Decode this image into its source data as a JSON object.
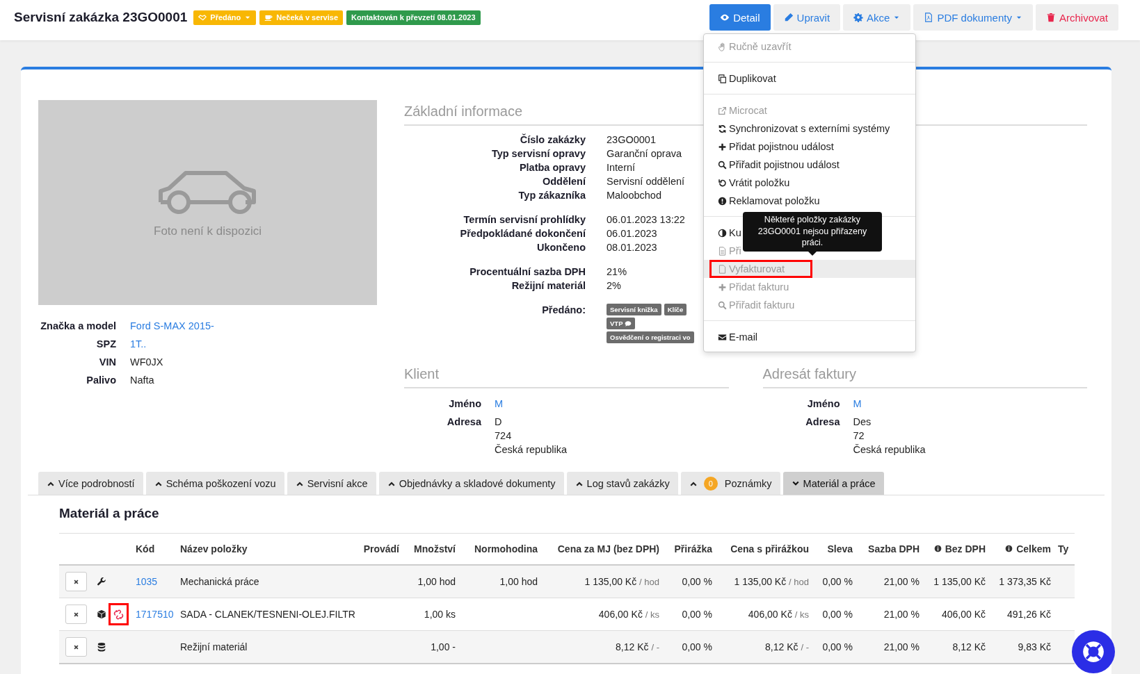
{
  "header": {
    "title": "Servisní zakázka 23GO0001",
    "badges": [
      {
        "label": "Předáno",
        "color": "#f8b704",
        "dropdown": true
      },
      {
        "label": "Nečeká v servise",
        "color": "#f8b704",
        "dropdown": false
      },
      {
        "label": "Kontaktován k převzetí 08.01.2023",
        "color": "#2f9a4c",
        "dropdown": false
      }
    ],
    "actions": [
      {
        "label": "Detail",
        "selected": true,
        "dropdown": false,
        "kind": "normal"
      },
      {
        "label": "Upravit",
        "selected": false,
        "dropdown": false,
        "kind": "normal"
      },
      {
        "label": "Akce",
        "selected": false,
        "dropdown": true,
        "kind": "normal"
      },
      {
        "label": "PDF dokumenty",
        "selected": false,
        "dropdown": true,
        "kind": "normal"
      },
      {
        "label": "Archivovat",
        "selected": false,
        "dropdown": false,
        "kind": "danger"
      }
    ]
  },
  "photo": {
    "caption": "Foto není k dispozici"
  },
  "vehicle": [
    {
      "label": "Značka a model",
      "value": "Ford S-MAX 2015-",
      "link": true
    },
    {
      "label": "SPZ",
      "value": "1T..",
      "link": true
    },
    {
      "label": "VIN",
      "value": "WF0JX",
      "link": false
    },
    {
      "label": "Palivo",
      "value": "Nafta",
      "link": false
    }
  ],
  "basic_info": {
    "title": "Základní informace",
    "groups": [
      [
        {
          "label": "Číslo zakázky",
          "value": "23GO0001"
        },
        {
          "label": "Typ servisní opravy",
          "value": "Garanční oprava"
        },
        {
          "label": "Platba opravy",
          "value": "Interní"
        },
        {
          "label": "Oddělení",
          "value": "Servisní oddělení"
        },
        {
          "label": "Typ zákazníka",
          "value": "Maloobchod"
        }
      ],
      [
        {
          "label": "Termín servisní prohlídky",
          "value": "06.01.2023 13:22"
        },
        {
          "label": "Předpokládané dokončení",
          "value": "06.01.2023"
        },
        {
          "label": "Ukončeno",
          "value": "08.01.2023"
        }
      ],
      [
        {
          "label": "Procentuální sazba DPH",
          "value": "21%"
        },
        {
          "label": "Režijní materiál",
          "value": "2%"
        }
      ]
    ],
    "handed_over": {
      "label": "Předáno:",
      "tags": [
        {
          "label": "Servisní knižka",
          "comment": false
        },
        {
          "label": "Klíče",
          "comment": false
        },
        {
          "label": "VTP",
          "comment": true
        },
        {
          "label": "Osvědčení o registraci vo",
          "comment": false
        }
      ]
    }
  },
  "parties": [
    {
      "title": "Klient",
      "name_label": "Jméno",
      "name": "M",
      "address_label": "Adresa",
      "address": [
        "D",
        "724",
        "Česká republika"
      ]
    },
    {
      "title": "Adresát faktury",
      "name_label": "Jméno",
      "name": "M",
      "address_label": "Adresa",
      "address": [
        "Des",
        "72",
        "Česká republika"
      ]
    }
  ],
  "actions_menu": {
    "items": [
      {
        "kind": "item",
        "label": "Ručně uzavřít",
        "disabled": true,
        "hovered": false,
        "marked": false
      },
      {
        "kind": "divider"
      },
      {
        "kind": "item",
        "label": "Duplikovat",
        "disabled": false,
        "hovered": false,
        "marked": false
      },
      {
        "kind": "divider"
      },
      {
        "kind": "item",
        "label": "Microcat",
        "disabled": true,
        "hovered": false,
        "marked": false
      },
      {
        "kind": "item",
        "label": "Synchronizovat s externími systémy",
        "disabled": false,
        "hovered": false,
        "marked": false
      },
      {
        "kind": "item",
        "label": "Přidat pojistnou událost",
        "disabled": false,
        "hovered": false,
        "marked": false
      },
      {
        "kind": "item",
        "label": "Přiřadit pojistnou událost",
        "disabled": false,
        "hovered": false,
        "marked": false
      },
      {
        "kind": "item",
        "label": "Vrátit položku",
        "disabled": false,
        "hovered": false,
        "marked": false
      },
      {
        "kind": "item",
        "label": "Reklamovat položku",
        "disabled": false,
        "hovered": false,
        "marked": false
      },
      {
        "kind": "divider"
      },
      {
        "kind": "item",
        "label": "Ku",
        "disabled": false,
        "hovered": false,
        "marked": false
      },
      {
        "kind": "item",
        "label": "Při",
        "disabled": true,
        "hovered": false,
        "marked": false
      },
      {
        "kind": "item",
        "label": "Vyfakturovat",
        "disabled": true,
        "hovered": true,
        "marked": true
      },
      {
        "kind": "item",
        "label": "Přidat fakturu",
        "disabled": true,
        "hovered": false,
        "marked": false
      },
      {
        "kind": "item",
        "label": "Přiřadit fakturu",
        "disabled": true,
        "hovered": false,
        "marked": false
      },
      {
        "kind": "divider"
      },
      {
        "kind": "item",
        "label": "E-mail",
        "disabled": false,
        "hovered": false,
        "marked": false
      }
    ]
  },
  "tooltip": {
    "text": "Některé položky zakázky 23GO0001 nejsou přiřazeny práci."
  },
  "detail_tabs": [
    {
      "label": "Více podrobností",
      "selected": false
    },
    {
      "label": "Schéma poškození vozu",
      "selected": false
    },
    {
      "label": "Servisní akce",
      "selected": false
    },
    {
      "label": "Objednávky a skladové dokumenty",
      "selected": false
    },
    {
      "label": "Log stavů zakázky",
      "selected": false
    },
    {
      "label": "Poznámky",
      "selected": false,
      "count": "0"
    },
    {
      "label": "Materiál a práce",
      "selected": true
    }
  ],
  "materials": {
    "title": "Materiál a práce",
    "columns": [
      {
        "label": "Kód",
        "info": false
      },
      {
        "label": "Název položky",
        "info": false
      },
      {
        "label": "Provádí",
        "info": false
      },
      {
        "label": "Množství",
        "info": false
      },
      {
        "label": "Normohodina",
        "info": false
      },
      {
        "label": "Cena za MJ (bez DPH)",
        "info": false
      },
      {
        "label": "Přirážka",
        "info": false
      },
      {
        "label": "Cena s přirážkou",
        "info": false
      },
      {
        "label": "Sleva",
        "info": false
      },
      {
        "label": "Sazba DPH",
        "info": false
      },
      {
        "label": "Bez DPH",
        "info": true
      },
      {
        "label": "Celkem",
        "info": true
      },
      {
        "label": "Ty",
        "info": false
      }
    ],
    "rows": [
      {
        "kind": "work",
        "unlinked": false,
        "marked": false,
        "code": "1035",
        "name": "Mechanická práce",
        "quantity": "1,00 hod",
        "standard_hours": "1,00 hod",
        "unit_price": "1 135,00 Kč",
        "unit_price_unit": "/ hod",
        "markup_unit": "/ hod",
        "markup": "0,00 %",
        "price_with_markup": "1 135,00 Kč",
        "discount": "0,00 %",
        "vat_rate": "21,00 %",
        "net": "1 135,00 Kč",
        "total": "1 373,35 Kč"
      },
      {
        "kind": "part",
        "unlinked": true,
        "marked": true,
        "code": "1717510",
        "name": "SADA - CLANEK/TESNENI-OLEJ.FILTR",
        "quantity": "1,00 ks",
        "unit_price": "406,00 Kč",
        "unit_price_unit": "/ ks",
        "markup_unit": "/ ks",
        "markup": "0,00 %",
        "price_with_markup": "406,00 Kč",
        "discount": "0,00 %",
        "vat_rate": "21,00 %",
        "net": "406,00 Kč",
        "total": "491,26 Kč"
      },
      {
        "kind": "overhead",
        "unlinked": false,
        "marked": false,
        "name": "Režijní materiál",
        "quantity": "1,00 -",
        "unit_price": "8,12 Kč",
        "unit_price_unit": "/ -",
        "markup_unit": "/ -",
        "markup": "0,00 %",
        "price_with_markup": "8,12 Kč",
        "discount": "0,00 %",
        "vat_rate": "21,00 %",
        "net": "8,12 Kč",
        "total": "9,83 Kč"
      }
    ]
  }
}
